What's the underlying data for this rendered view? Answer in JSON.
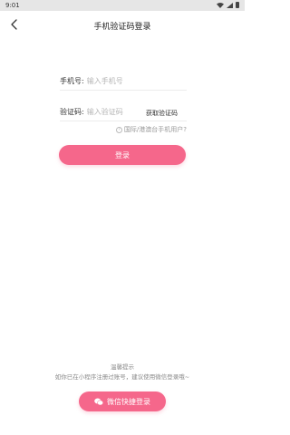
{
  "status_bar": {
    "time": "9:01",
    "icons": [
      "wifi-icon",
      "signal-icon",
      "battery-icon"
    ]
  },
  "header": {
    "title": "手机验证码登录",
    "back_icon": "chevron-left-icon"
  },
  "form": {
    "phone_label": "手机号:",
    "phone_placeholder": "输入手机号",
    "phone_value": "",
    "code_label": "验证码:",
    "code_placeholder": "输入验证码",
    "code_value": "",
    "get_code_label": "获取验证码"
  },
  "intl_link": {
    "icon": "help-circle-icon",
    "text": "国际/港澳台手机用户?"
  },
  "login_button": {
    "label": "登录"
  },
  "tip": {
    "title": "温馨提示",
    "text": "如你已在小程序注册过账号，建议使用微信登录哦~"
  },
  "wechat_button": {
    "icon": "wechat-icon",
    "label": "微信快捷登录"
  },
  "colors": {
    "accent": "#f5678b",
    "status_bar_bg": "#e6e6e6"
  }
}
